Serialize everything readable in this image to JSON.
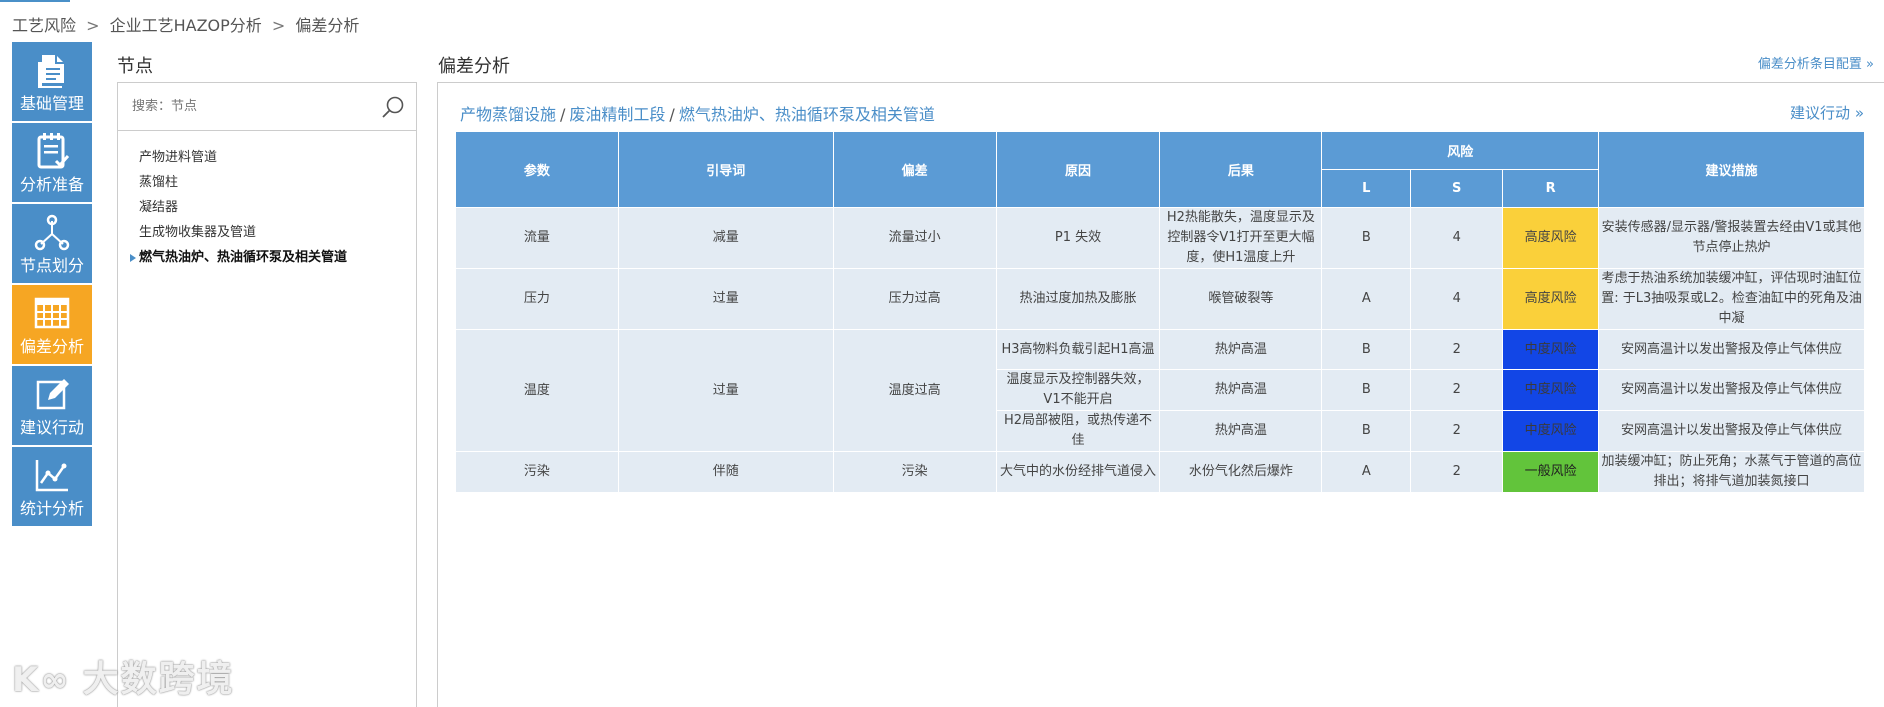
{
  "breadcrumb": [
    "工艺风险",
    "企业工艺HAZOP分析",
    "偏差分析"
  ],
  "breadcrumb_sep": ">",
  "sidebar": {
    "items": [
      {
        "label": "基础管理",
        "icon": "document-icon"
      },
      {
        "label": "分析准备",
        "icon": "checklist-icon"
      },
      {
        "label": "节点划分",
        "icon": "share-nodes-icon"
      },
      {
        "label": "偏差分析",
        "icon": "grid-table-icon"
      },
      {
        "label": "建议行动",
        "icon": "edit-icon"
      },
      {
        "label": "统计分析",
        "icon": "chart-line-icon"
      }
    ],
    "active_index": 3,
    "color": "#4a8ec8",
    "active_color": "#f6a623"
  },
  "node": {
    "title": "节点",
    "search_placeholder": "搜索：节点",
    "items": [
      "产物进料管道",
      "蒸馏柱",
      "凝结器",
      "生成物收集器及管道",
      "燃气热油炉、热油循环泵及相关管道"
    ],
    "active_index": 4
  },
  "main": {
    "title": "偏差分析",
    "config_link": "偏差分析条目配置 »",
    "path": [
      "产物蒸馏设施",
      "废油精制工段",
      "燃气热油炉、热油循环泵及相关管道"
    ],
    "path_sep": "/",
    "suggest_link": "建议行动 »"
  },
  "table": {
    "headers": {
      "param": "参数",
      "guide": "引导词",
      "deviation": "偏差",
      "cause": "原因",
      "consequence": "后果",
      "risk": "风险",
      "L": "L",
      "S": "S",
      "R": "R",
      "measure": "建议措施"
    },
    "rows": [
      {
        "param": "流量",
        "guide": "减量",
        "deviation": "流量过小",
        "cause": "P1 失效",
        "consequence": "H2热能散失，温度显示及控制器令V1打开至更大幅度，使H1温度上升",
        "L": "B",
        "S": "4",
        "R": "高度风险",
        "level": "high",
        "measure": "安装传感器/显示器/警报装置去经由V1或其他节点停止热炉"
      },
      {
        "param": "压力",
        "guide": "过量",
        "deviation": "压力过高",
        "cause": "热油过度加热及膨胀",
        "consequence": "喉管破裂等",
        "L": "A",
        "S": "4",
        "R": "高度风险",
        "level": "high",
        "measure": "考虑于热油系统加装缓冲缸，评估现时油缸位置: 于L3抽吸泵或L2。检查油缸中的死角及油中凝"
      },
      {
        "param": "温度",
        "guide": "过量",
        "deviation": "温度过高",
        "cause": "H3高物料负载引起H1高温",
        "consequence": "热炉高温",
        "L": "B",
        "S": "2",
        "R": "中度风险",
        "level": "mid",
        "measure": "安网高温计以发出警报及停止气体供应"
      },
      {
        "cause": "温度显示及控制器失效，V1不能开启",
        "consequence": "热炉高温",
        "L": "B",
        "S": "2",
        "R": "中度风险",
        "level": "mid",
        "measure": "安网高温计以发出警报及停止气体供应"
      },
      {
        "cause": "H2局部被阻，或热传递不佳",
        "consequence": "热炉高温",
        "L": "B",
        "S": "2",
        "R": "中度风险",
        "level": "mid",
        "measure": "安网高温计以发出警报及停止气体供应"
      },
      {
        "param": "污染",
        "guide": "伴随",
        "deviation": "污染",
        "cause": "大气中的水份经排气道侵入",
        "consequence": "水份气化然后爆炸",
        "L": "A",
        "S": "2",
        "R": "一般风险",
        "level": "low",
        "measure": "加装缓冲缸；防止死角；水蒸气于管道的高位排出；将排气道加装氮接口"
      }
    ],
    "colors": {
      "header": "#5b9bd5",
      "cell": "#e3ebf3",
      "high": "#fad03a",
      "mid": "#1246e6",
      "low": "#62c43b"
    }
  },
  "watermark": {
    "logo": "K∞",
    "text": "大数跨境"
  }
}
